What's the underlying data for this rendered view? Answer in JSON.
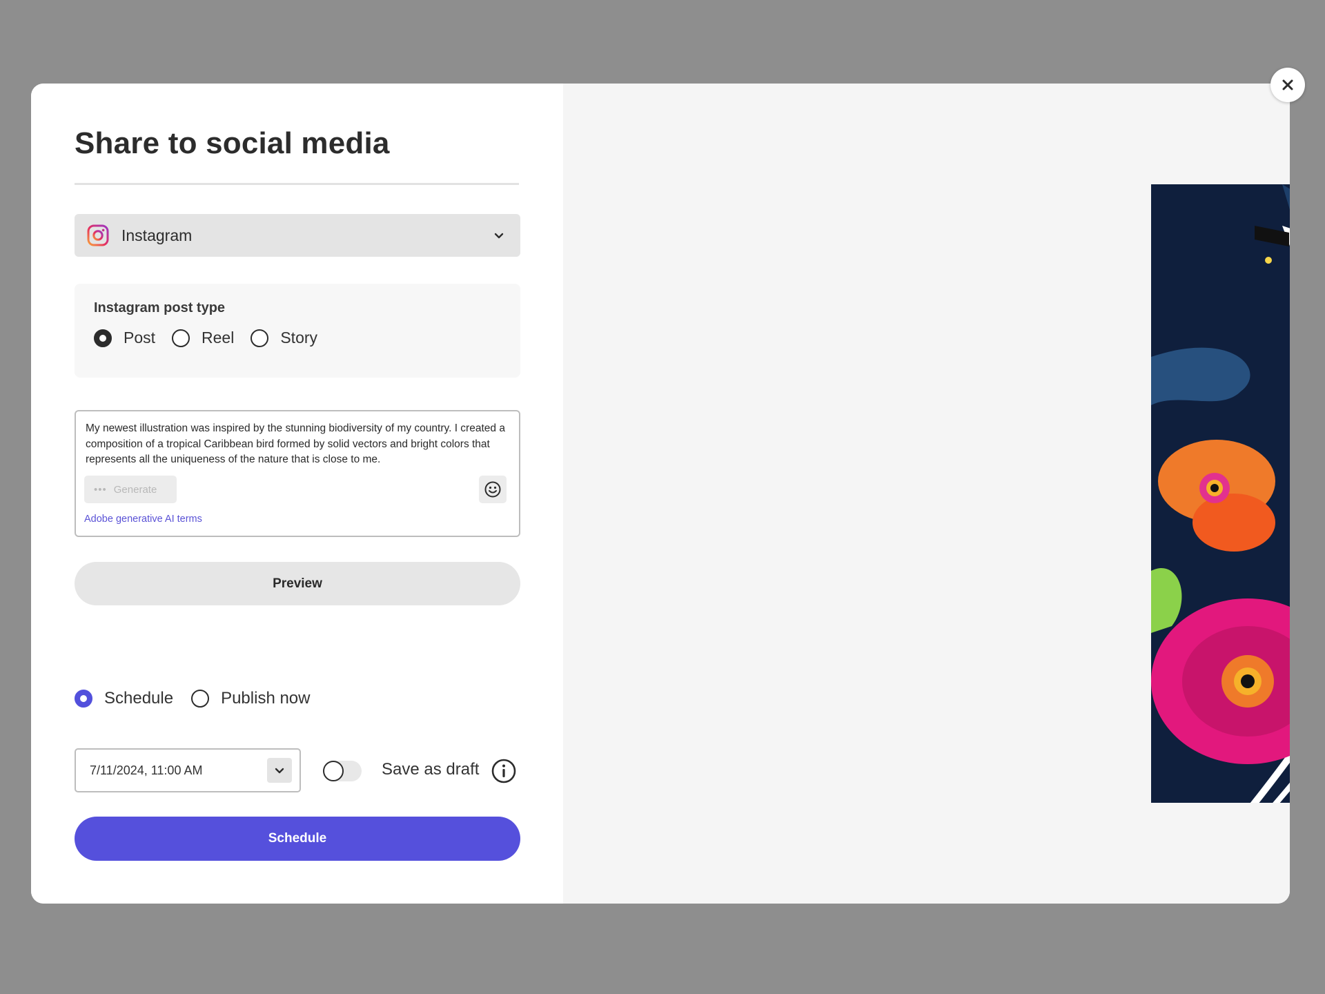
{
  "dialog": {
    "title": "Share to social media",
    "close_icon": "close-icon"
  },
  "platform": {
    "selected": "Instagram",
    "icon": "instagram-icon"
  },
  "post_type": {
    "title": "Instagram post type",
    "options": [
      {
        "label": "Post",
        "selected": true
      },
      {
        "label": "Reel",
        "selected": false
      },
      {
        "label": "Story",
        "selected": false
      }
    ]
  },
  "caption": {
    "text": "My newest illustration was inspired by the stunning biodiversity of my country. I created a composition of a tropical Caribbean bird formed by solid vectors and bright colors that represents all the uniqueness of the nature that is close to me.",
    "generate_label": "Generate",
    "ai_terms_label": "Adobe generative AI terms"
  },
  "preview_label": "Preview",
  "publish": {
    "options": [
      {
        "label": "Schedule",
        "selected": true
      },
      {
        "label": "Publish now",
        "selected": false
      }
    ],
    "datetime": "7/11/2024, 11:00 AM",
    "save_as_draft_label": "Save as draft",
    "save_as_draft_on": false
  },
  "schedule_button_label": "Schedule",
  "colors": {
    "accent": "#5550dc",
    "overlay": "#8e8e8e",
    "artwork_background": "#0f1f3d"
  }
}
